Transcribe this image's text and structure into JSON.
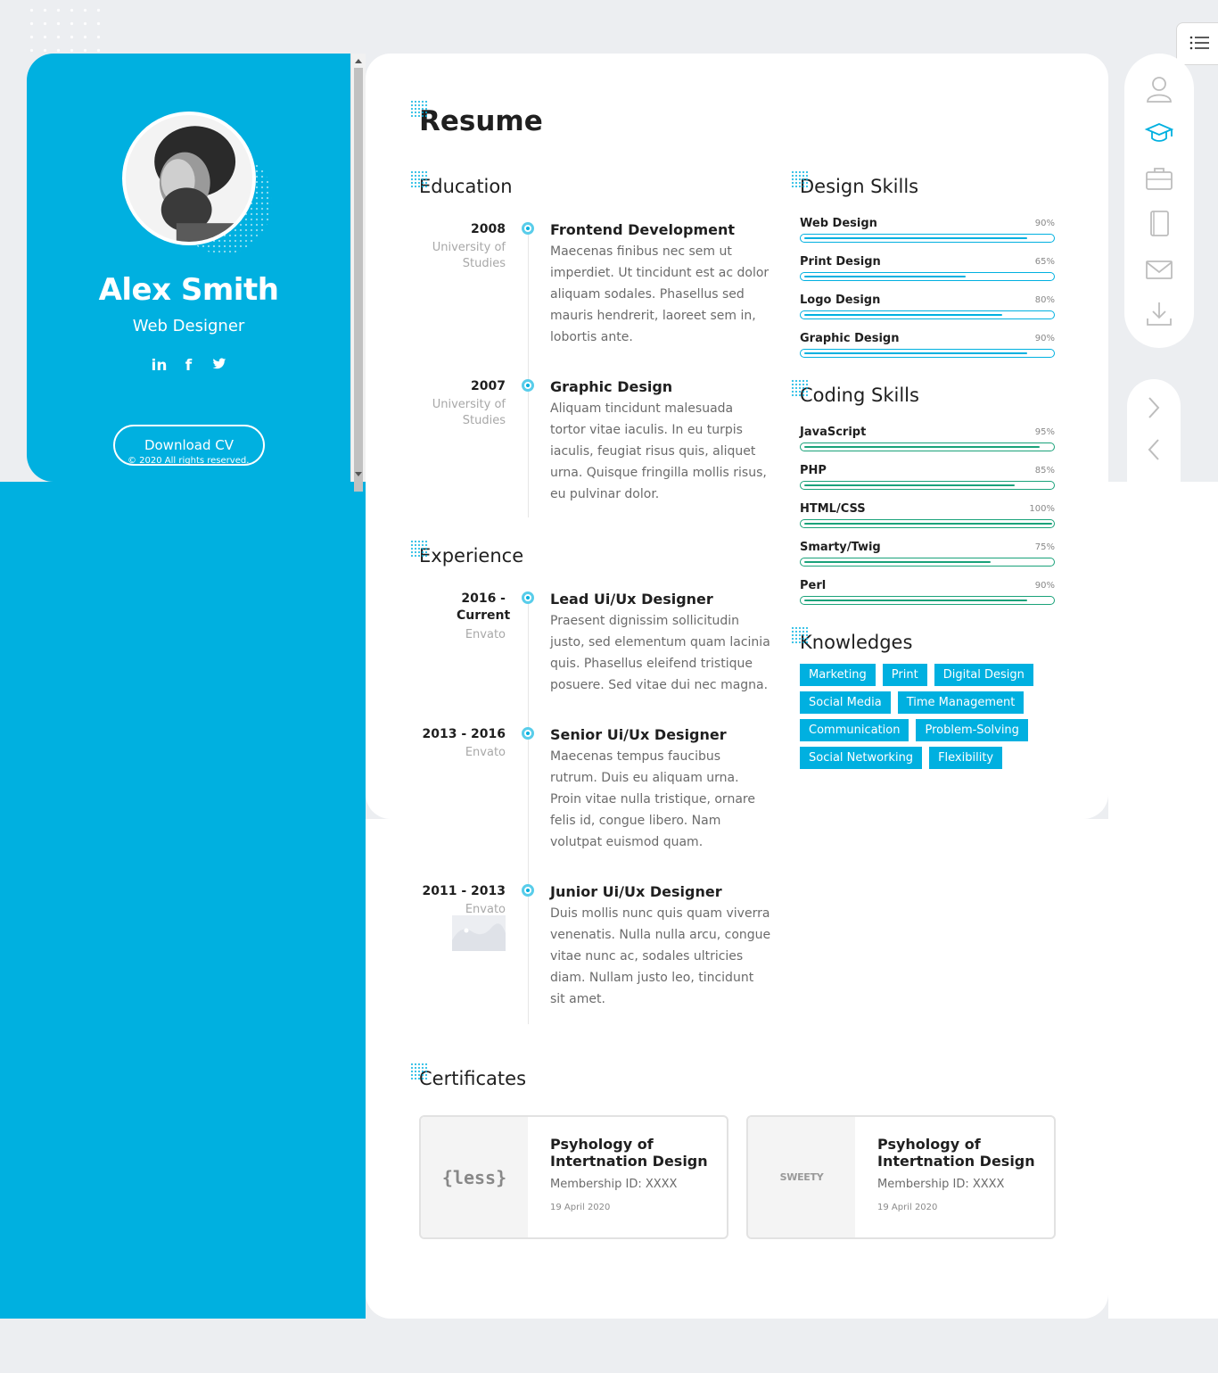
{
  "profile": {
    "name": "Alex Smith",
    "role": "Web Designer",
    "socials": [
      {
        "icon": "linkedin-icon",
        "glyph": "in"
      },
      {
        "icon": "facebook-icon",
        "glyph": "f"
      },
      {
        "icon": "twitter-icon",
        "glyph": "🐦"
      }
    ],
    "download_label": "Download CV",
    "copyright": "© 2020 All rights reserved."
  },
  "resume": {
    "title": "Resume",
    "education": {
      "heading": "Education",
      "items": [
        {
          "year": "2008",
          "place": "University of Studies",
          "title": "Frontend Development",
          "desc": "Maecenas finibus nec sem ut imperdiet. Ut tincidunt est ac dolor aliquam sodales. Phasellus sed mauris hendrerit, laoreet sem in, lobortis ante."
        },
        {
          "year": "2007",
          "place": "University of Studies",
          "title": "Graphic Design",
          "desc": "Aliquam tincidunt malesuada tortor vitae iaculis. In eu turpis iaculis, feugiat risus quis, aliquet urna. Quisque fringilla mollis risus, eu pulvinar dolor."
        }
      ]
    },
    "experience": {
      "heading": "Experience",
      "items": [
        {
          "year": "2016 - Current",
          "place": "Envato",
          "title": "Lead Ui/Ux Designer",
          "desc": "Praesent dignissim sollicitudin justo, sed elementum quam lacinia quis. Phasellus eleifend tristique posuere. Sed vitae dui nec magna."
        },
        {
          "year": "2013 - 2016",
          "place": "Envato",
          "title": "Senior Ui/Ux Designer",
          "desc": "Maecenas tempus faucibus rutrum. Duis eu aliquam urna. Proin vitae nulla tristique, ornare felis id, congue libero. Nam volutpat euismod quam."
        },
        {
          "year": "2011 - 2013",
          "place": "Envato",
          "title": "Junior Ui/Ux Designer",
          "desc": "Duis mollis nunc quis quam viverra venenatis. Nulla nulla arcu, congue vitae nunc ac, sodales ultricies diam. Nullam justo leo, tincidunt sit amet."
        }
      ]
    },
    "design_skills": {
      "heading": "Design Skills",
      "items": [
        {
          "label": "Web Design",
          "pct": "90%",
          "value": 0.9
        },
        {
          "label": "Print Design",
          "pct": "65%",
          "value": 0.65
        },
        {
          "label": "Logo Design",
          "pct": "80%",
          "value": 0.8
        },
        {
          "label": "Graphic Design",
          "pct": "90%",
          "value": 0.9
        }
      ]
    },
    "coding_skills": {
      "heading": "Coding Skills",
      "items": [
        {
          "label": "JavaScript",
          "pct": "95%",
          "value": 0.95
        },
        {
          "label": "PHP",
          "pct": "85%",
          "value": 0.85
        },
        {
          "label": "HTML/CSS",
          "pct": "100%",
          "value": 1.0
        },
        {
          "label": "Smarty/Twig",
          "pct": "75%",
          "value": 0.75
        },
        {
          "label": "Perl",
          "pct": "90%",
          "value": 0.9
        }
      ]
    },
    "knowledges": {
      "heading": "Knowledges",
      "tags": [
        "Marketing",
        "Print",
        "Digital Design",
        "Social Media",
        "Time Management",
        "Communication",
        "Problem-Solving",
        "Social Networking",
        "Flexibility"
      ]
    },
    "certificates": {
      "heading": "Certificates",
      "items": [
        {
          "logo": "{less}",
          "title": "Psyhology of Intertnation Design",
          "id": "Membership ID: XXXX",
          "date": "19 April 2020"
        },
        {
          "logo": "SWEETY",
          "title": "Psyhology of Intertnation Design",
          "id": "Membership ID: XXXX",
          "date": "19 April 2020"
        }
      ]
    }
  },
  "nav": {
    "icons": [
      "user-icon",
      "graduation-cap-icon",
      "briefcase-icon",
      "book-icon",
      "mail-icon",
      "download-icon"
    ],
    "active": "graduation-cap-icon",
    "arrows": [
      "chevron-right-icon",
      "chevron-left-icon"
    ]
  },
  "colors": {
    "accent": "#00b0e0",
    "coding": "#1aa27a",
    "design_fill": "#00b0e0"
  }
}
